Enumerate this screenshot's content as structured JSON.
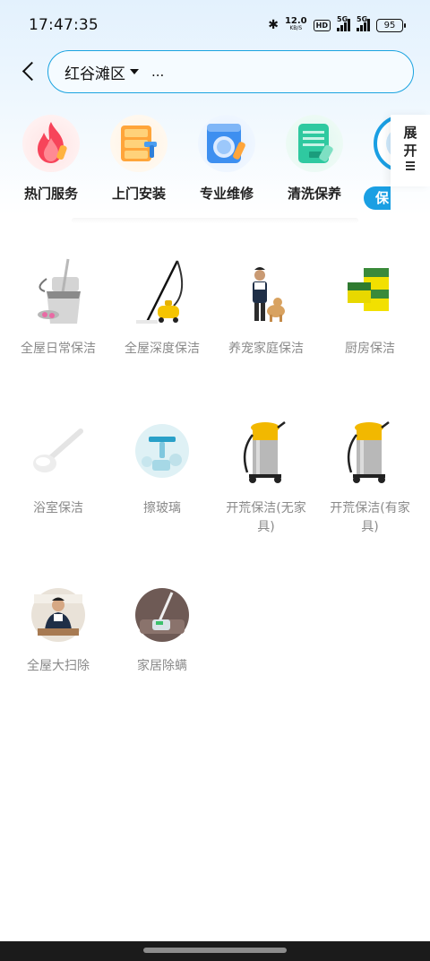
{
  "status_bar": {
    "time": "17:47:35",
    "net_speed_value": "12.0",
    "net_speed_unit": "KB/S",
    "hd_label": "HD",
    "sim1_label": "5G",
    "sim2_label": "5G",
    "battery": "95"
  },
  "header": {
    "location": "红谷滩区",
    "search_text": "..."
  },
  "categories": [
    {
      "label": "热门服务",
      "icon": "fire-icon",
      "color": "#f7445a"
    },
    {
      "label": "上门安装",
      "icon": "cabinet-install-icon",
      "color": "#ffa53a"
    },
    {
      "label": "专业维修",
      "icon": "washing-machine-repair-icon",
      "color": "#3d8ff0"
    },
    {
      "label": "清洗保养",
      "icon": "cleaning-doc-icon",
      "color": "#2fc9a0"
    },
    {
      "label": "保",
      "icon": "cleaning-icon",
      "color": "#1a9fe3",
      "active": true
    }
  ],
  "expand": {
    "line1": "展",
    "line2": "开"
  },
  "services": [
    {
      "label": "全屋日常保洁",
      "icon": "mop-bucket-icon"
    },
    {
      "label": "全屋深度保洁",
      "icon": "steam-cleaner-icon"
    },
    {
      "label": "养宠家庭保洁",
      "icon": "pet-cleaner-icon"
    },
    {
      "label": "厨房保洁",
      "icon": "sponge-icon"
    },
    {
      "label": "浴室保洁",
      "icon": "bath-brush-icon"
    },
    {
      "label": "擦玻璃",
      "icon": "window-squeegee-icon"
    },
    {
      "label": "开荒保洁(无家具)",
      "icon": "vacuum-cleaner-icon"
    },
    {
      "label": "开荒保洁(有家具)",
      "icon": "vacuum-cleaner-icon"
    },
    {
      "label": "全屋大扫除",
      "icon": "cleaner-person-icon"
    },
    {
      "label": "家居除螨",
      "icon": "mite-remover-icon"
    }
  ],
  "colors": {
    "accent": "#1a9fe3",
    "label_gray": "#8a8a8a"
  }
}
